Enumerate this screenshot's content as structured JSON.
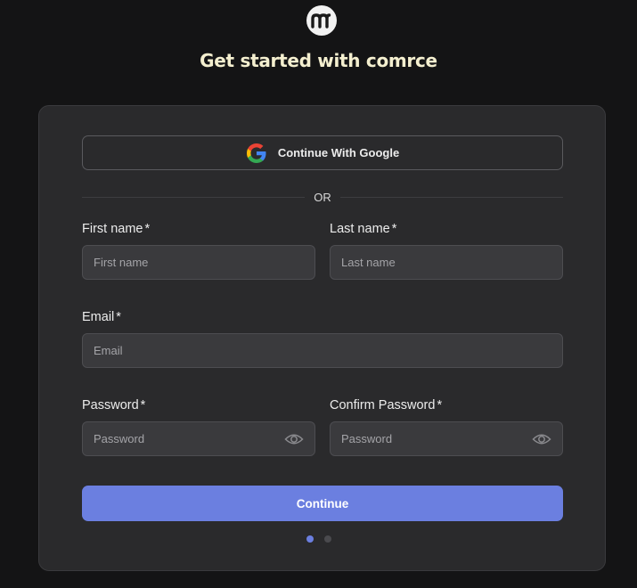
{
  "brand": {
    "logo_icon": "comrce-logo-icon",
    "headline": "Get started with comrce"
  },
  "signup_form": {
    "google_button": {
      "label": "Continue With Google",
      "icon": "google-g-icon"
    },
    "divider_text": "OR",
    "first_name": {
      "label": "First name",
      "required_mark": "*",
      "placeholder": "First name"
    },
    "last_name": {
      "label": "Last name",
      "required_mark": "*",
      "placeholder": "Last name"
    },
    "email": {
      "label": "Email",
      "required_mark": "*",
      "placeholder": "Email"
    },
    "password": {
      "label": "Password",
      "required_mark": "*",
      "placeholder": "Password",
      "toggle_icon": "eye-icon"
    },
    "confirm_password": {
      "label": "Confirm Password",
      "required_mark": "*",
      "placeholder": "Password",
      "toggle_icon": "eye-icon"
    },
    "continue_button": {
      "label": "Continue"
    },
    "step_indicator": {
      "current_step": 1,
      "total_steps": 2
    }
  },
  "colors": {
    "page_background": "#141415",
    "card_background": "#2a2a2c",
    "accent": "#6b7fe0",
    "headline": "#f4efcf"
  }
}
